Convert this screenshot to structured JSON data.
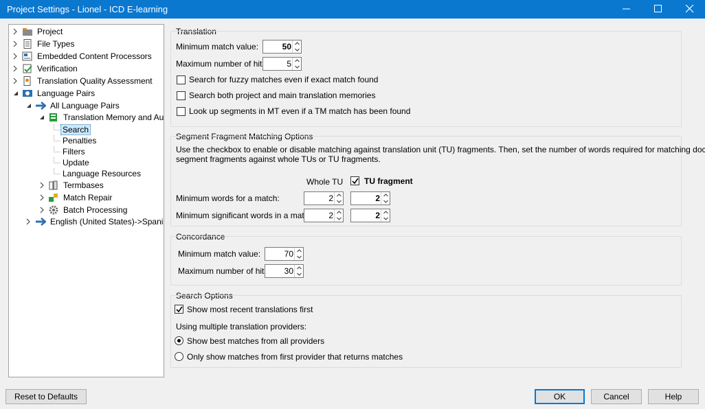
{
  "window": {
    "title": "Project Settings - Lionel - ICD E-learning"
  },
  "tree": {
    "items": [
      {
        "label": "Project",
        "icon": "project-icon"
      },
      {
        "label": "File Types",
        "icon": "file-types-icon"
      },
      {
        "label": "Embedded Content Processors",
        "icon": "embedded-content-icon"
      },
      {
        "label": "Verification",
        "icon": "verification-icon"
      },
      {
        "label": "Translation Quality Assessment",
        "icon": "tqa-icon"
      },
      {
        "label": "Language Pairs",
        "icon": "language-pairs-icon"
      },
      {
        "label": "All Language Pairs",
        "icon": "arrow-right-icon"
      },
      {
        "label": "Translation Memory and Aut",
        "icon": "translation-memory-icon"
      },
      {
        "label": "Search",
        "icon": ""
      },
      {
        "label": "Penalties",
        "icon": ""
      },
      {
        "label": "Filters",
        "icon": ""
      },
      {
        "label": "Update",
        "icon": ""
      },
      {
        "label": "Language Resources",
        "icon": ""
      },
      {
        "label": "Termbases",
        "icon": "termbases-icon"
      },
      {
        "label": "Match Repair",
        "icon": "match-repair-icon"
      },
      {
        "label": "Batch Processing",
        "icon": "gear-icon"
      },
      {
        "label": "English (United States)->Spanis",
        "icon": "arrow-right-icon"
      }
    ],
    "selected": "Search"
  },
  "translation": {
    "title": "Translation",
    "min_match_label": "Minimum match value:",
    "min_match_value": "50",
    "max_hits_label": "Maximum number of hits:",
    "max_hits_value": "5",
    "fuzzy_label": "Search for fuzzy matches even if exact match found",
    "fuzzy_checked": false,
    "both_label": "Search both project and main translation memories",
    "both_checked": false,
    "mt_label": "Look up segments in MT even if a TM match has been found",
    "mt_checked": false
  },
  "fragment": {
    "title": "Segment Fragment Matching Options",
    "desc_line1": "Use the checkbox to enable or disable matching against translation unit (TU) fragments. Then, set the number of words required for matching document",
    "desc_line2": "segment fragments against whole TUs or TU fragments.",
    "whole_tu_header": "Whole TU",
    "tu_fragment_header": "TU fragment",
    "tu_fragment_checked": true,
    "min_words_label": "Minimum words for a match:",
    "min_words_whole": "2",
    "min_words_fragment": "2",
    "min_sig_label": "Minimum significant words in a match:",
    "min_sig_whole": "2",
    "min_sig_fragment": "2"
  },
  "concordance": {
    "title": "Concordance",
    "min_match_label": "Minimum match value:",
    "min_match_value": "70",
    "max_hits_label": "Maximum number of hits:",
    "max_hits_value": "30"
  },
  "search_options": {
    "title": "Search Options",
    "recent_label": "Show most recent translations first",
    "recent_checked": true,
    "providers_label": "Using multiple translation providers:",
    "best_label": "Show best matches from all providers",
    "first_label": "Only show matches from first provider that returns matches",
    "selected_option": "best"
  },
  "buttons": {
    "reset": "Reset to Defaults",
    "ok": "OK",
    "cancel": "Cancel",
    "help": "Help"
  },
  "colors": {
    "titlebar": "#0b78d0",
    "accent": "#0078d7"
  }
}
